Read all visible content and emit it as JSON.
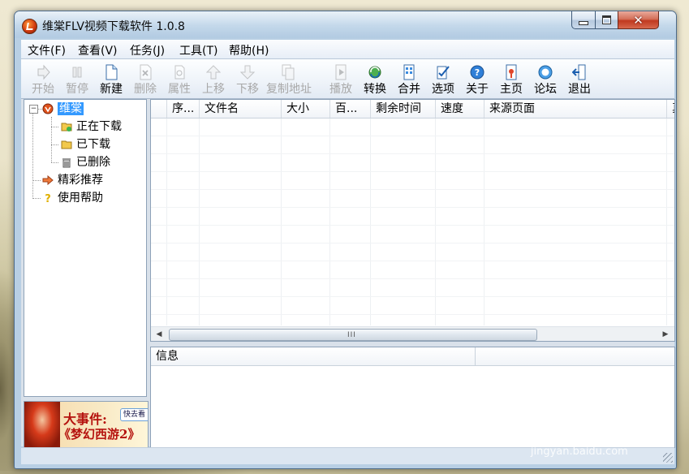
{
  "window": {
    "title": "维棠FLV视频下载软件 1.0.8"
  },
  "menu": [
    {
      "label": "文件(F)"
    },
    {
      "label": "查看(V)"
    },
    {
      "label": "任务(J)"
    },
    {
      "label": "工具(T)"
    },
    {
      "label": "帮助(H)"
    }
  ],
  "toolbar": [
    {
      "label": "开始",
      "icon": "play-arrow-icon",
      "enabled": false
    },
    {
      "label": "暂停",
      "icon": "pause-icon",
      "enabled": false
    },
    {
      "label": "新建",
      "icon": "new-document-icon",
      "enabled": true
    },
    {
      "label": "删除",
      "icon": "delete-document-icon",
      "enabled": false
    },
    {
      "label": "属性",
      "icon": "properties-icon",
      "enabled": false
    },
    {
      "label": "上移",
      "icon": "move-up-icon",
      "enabled": false
    },
    {
      "label": "下移",
      "icon": "move-down-icon",
      "enabled": false
    },
    {
      "label": "复制地址",
      "icon": "copy-address-icon",
      "enabled": false
    },
    {
      "label": "播放",
      "icon": "play-media-icon",
      "enabled": false
    },
    {
      "label": "转换",
      "icon": "convert-icon",
      "enabled": true
    },
    {
      "label": "合并",
      "icon": "merge-icon",
      "enabled": true
    },
    {
      "label": "选项",
      "icon": "options-icon",
      "enabled": true
    },
    {
      "label": "关于",
      "icon": "about-icon",
      "enabled": true
    },
    {
      "label": "主页",
      "icon": "homepage-icon",
      "enabled": true
    },
    {
      "label": "论坛",
      "icon": "forum-icon",
      "enabled": true
    },
    {
      "label": "退出",
      "icon": "exit-icon",
      "enabled": true
    }
  ],
  "tree": {
    "root": {
      "label": "维棠",
      "icon": "weitang-logo-icon",
      "selected": true,
      "expander": "−"
    },
    "children": [
      {
        "label": "正在下载",
        "icon": "downloading-folder-icon"
      },
      {
        "label": "已下载",
        "icon": "downloaded-folder-icon"
      },
      {
        "label": "已删除",
        "icon": "trash-icon"
      }
    ],
    "siblings": [
      {
        "label": "精彩推荐",
        "icon": "recommend-arrow-icon"
      },
      {
        "label": "使用帮助",
        "icon": "help-question-icon"
      }
    ]
  },
  "banner": {
    "line1": "大事件:",
    "line2": "《梦幻西游2》",
    "tag": "快去看"
  },
  "task_list": {
    "columns": [
      {
        "label": ""
      },
      {
        "label": "序..."
      },
      {
        "label": "文件名"
      },
      {
        "label": "大小"
      },
      {
        "label": "百..."
      },
      {
        "label": "剩余时间"
      },
      {
        "label": "速度"
      },
      {
        "label": "来源页面"
      },
      {
        "label": "真"
      }
    ],
    "rows": [],
    "scroll_grip": "III"
  },
  "info_panel": {
    "columns": [
      {
        "label": "信息"
      },
      {
        "label": ""
      }
    ]
  },
  "watermark": {
    "brand": "Bai du 经验",
    "url": "jingyan.baidu.com"
  },
  "colors": {
    "selection": "#3399ff",
    "close_button": "#c0391f",
    "disabled_text": "#a8a8a8"
  }
}
